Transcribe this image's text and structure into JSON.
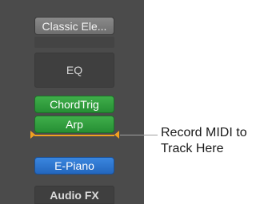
{
  "channel_strip": {
    "instrument_slot": "Classic Ele...",
    "eq_button": "EQ",
    "midi_fx": [
      {
        "label": "ChordTrig",
        "color": "#2f9e3d"
      },
      {
        "label": "Arp",
        "color": "#2f9e3d"
      }
    ],
    "output_slot": {
      "label": "E-Piano",
      "color": "#2f74d0"
    },
    "audio_fx_label": "Audio FX",
    "record_marker_color": "#f0a020"
  },
  "callout": {
    "line1": "Record MIDI to",
    "line2": "Track Here"
  }
}
